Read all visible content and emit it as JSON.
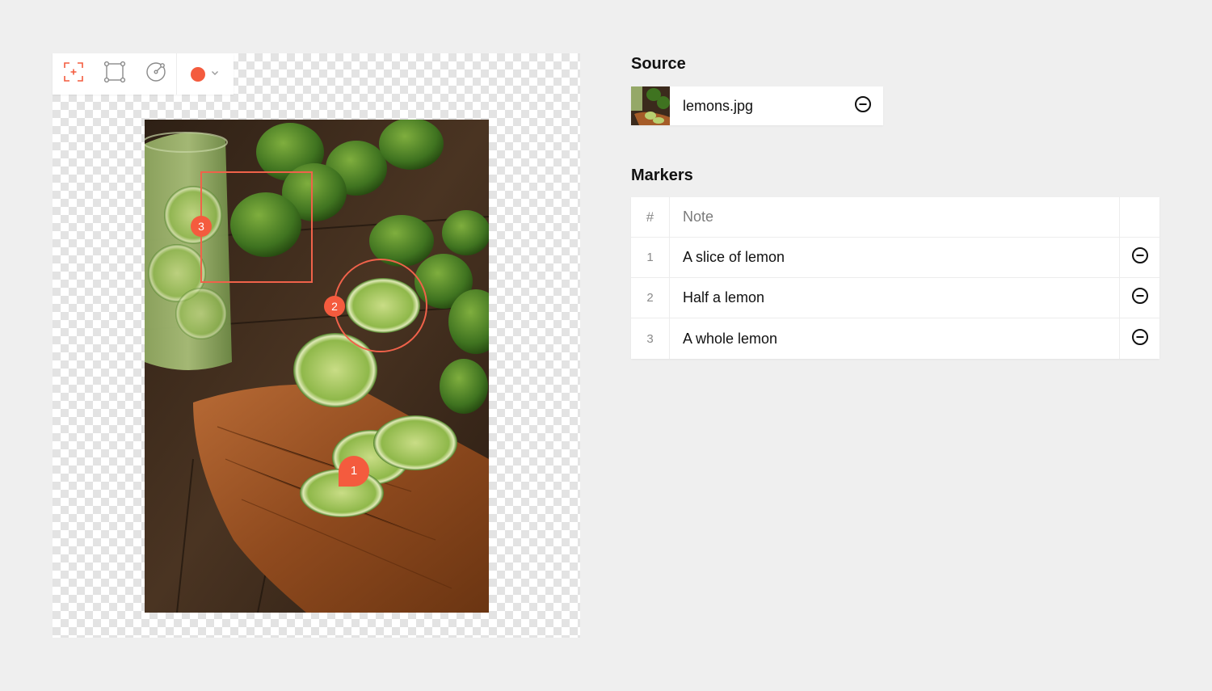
{
  "toolbar": {
    "tools": [
      {
        "name": "pin-tool",
        "icon": "pin-target-icon"
      },
      {
        "name": "rect-tool",
        "icon": "rectangle-select-icon"
      },
      {
        "name": "circle-tool",
        "icon": "circle-select-icon"
      }
    ],
    "color": {
      "value": "#f45b3e",
      "icon": "chevron-down-icon"
    }
  },
  "image_markers": {
    "pin": "1",
    "circle": "2",
    "rect": "3"
  },
  "source": {
    "title": "Source",
    "file_name": "lemons.jpg",
    "remove_icon": "minus-circle-icon"
  },
  "markers": {
    "title": "Markers",
    "columns": {
      "number": "#",
      "note": "Note"
    },
    "rows": [
      {
        "number": "1",
        "note": "A slice of lemon"
      },
      {
        "number": "2",
        "note": "Half a lemon"
      },
      {
        "number": "3",
        "note": "A whole lemon"
      }
    ]
  },
  "colors": {
    "accent": "#f45b3e",
    "background": "#efefef"
  }
}
